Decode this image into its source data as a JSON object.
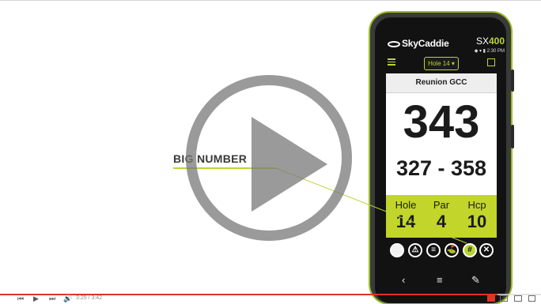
{
  "phone": {
    "brand": "SkyCaddie",
    "model_prefix": "SX",
    "model_number": "400",
    "status_time": "2:30 PM",
    "hole_select": "Hole 14",
    "course_name": "Reunion GCC",
    "big_number": "343",
    "range": "327 - 358",
    "info": {
      "hole_label": "Hole",
      "hole_value": "14",
      "par_label": "Par",
      "par_value": "4",
      "hcp_label": "Hcp",
      "hcp_value": "10"
    },
    "icons": [
      "ball-icon",
      "hazard-icon",
      "list-icon",
      "green-icon",
      "number-icon",
      "close-icon"
    ],
    "nav": {
      "back": "‹",
      "home": "≡",
      "edit": "✎"
    }
  },
  "callout": {
    "label": "BIG NUMBER"
  },
  "player": {
    "time": "3:25 / 3:42",
    "progress": 0.92,
    "accent": "#e1322a"
  },
  "colors": {
    "brand_green": "#b9d532",
    "info_green": "#c2d52a"
  }
}
